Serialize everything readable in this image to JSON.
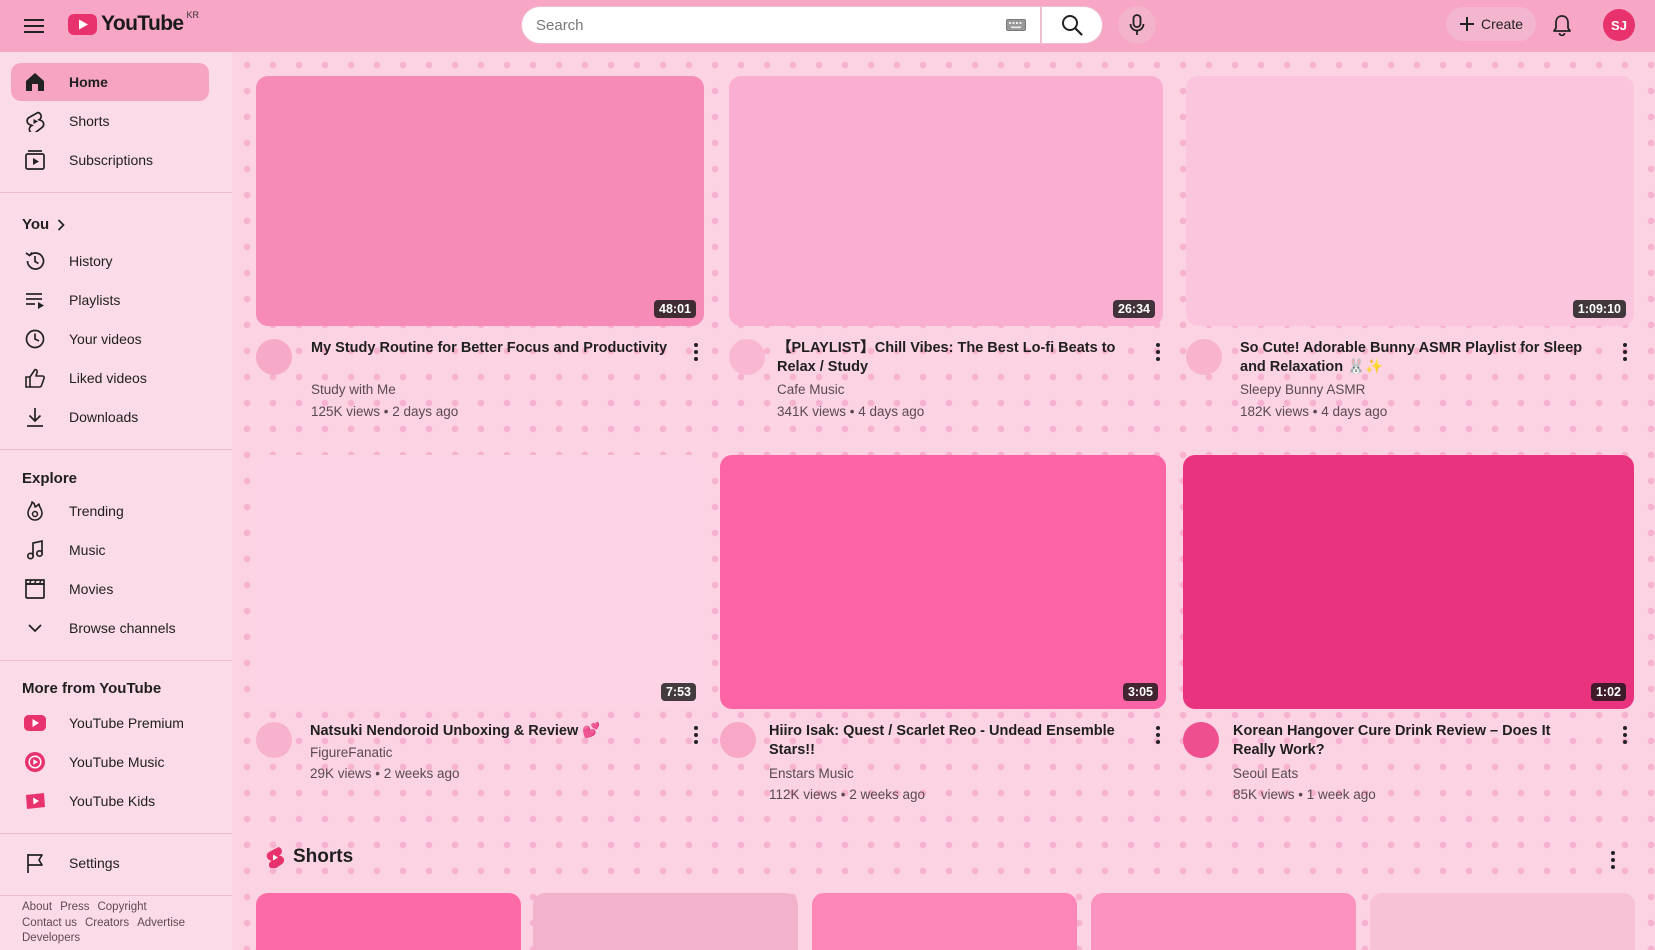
{
  "header": {
    "logo_text": "YouTube",
    "region": "KR",
    "search_placeholder": "Search",
    "create_label": "Create",
    "avatar_initials": "SJ"
  },
  "sidebar": {
    "main": [
      {
        "label": "Home",
        "icon": "home-icon"
      },
      {
        "label": "Shorts",
        "icon": "shorts-icon"
      },
      {
        "label": "Subscriptions",
        "icon": "subscriptions-icon"
      }
    ],
    "you_title": "You",
    "you": [
      {
        "label": "History",
        "icon": "history-icon"
      },
      {
        "label": "Playlists",
        "icon": "playlists-icon"
      },
      {
        "label": "Your videos",
        "icon": "your-videos-icon"
      },
      {
        "label": "Liked videos",
        "icon": "thumbs-up-icon"
      },
      {
        "label": "Downloads",
        "icon": "download-icon"
      }
    ],
    "explore_title": "Explore",
    "explore": [
      {
        "label": "Trending",
        "icon": "trending-icon"
      },
      {
        "label": "Music",
        "icon": "music-note-icon"
      },
      {
        "label": "Movies",
        "icon": "clapperboard-icon"
      },
      {
        "label": "Browse channels",
        "icon": "chevron-down-icon"
      }
    ],
    "more_title": "More from YouTube",
    "more": [
      {
        "label": "YouTube Premium",
        "icon": "youtube-premium-icon"
      },
      {
        "label": "YouTube Music",
        "icon": "youtube-music-icon"
      },
      {
        "label": "YouTube Kids",
        "icon": "youtube-kids-icon"
      }
    ],
    "settings_label": "Settings",
    "footer": {
      "line1": [
        "About",
        "Press",
        "Copyright"
      ],
      "line2": [
        "Contact us",
        "Creators",
        "Advertise"
      ],
      "line3": [
        "Developers"
      ]
    }
  },
  "videos": [
    {
      "title": "My Study Routine for Better Focus and Productivity",
      "channel": "Study with Me",
      "meta": "125K views • 2 days ago",
      "duration": "48:01",
      "thumb_color": "#f58bb6",
      "avatar_color": "#f7a9c8"
    },
    {
      "title": "【PLAYLIST】Chill Vibes: The Best Lo-fi Beats to Relax / Study",
      "channel": "Cafe Music",
      "meta": "341K views • 4 days ago",
      "duration": "26:34",
      "thumb_color": "#faafd2",
      "avatar_color": "#f9b7d2"
    },
    {
      "title": "So Cute! Adorable Bunny ASMR Playlist for Sleep and Relaxation 🐰✨",
      "channel": "Sleepy Bunny ASMR",
      "meta": "182K views • 4 days ago",
      "duration": "1:09:10",
      "thumb_color": "#fbc6dd",
      "avatar_color": "#f8b3cd"
    },
    {
      "title": "Natsuki Nendoroid Unboxing & Review 💕",
      "channel": "FigureFanatic",
      "meta": "29K views • 2 weeks ago",
      "duration": "7:53",
      "thumb_color": "#fcd4e5",
      "avatar_color": "#f7b2cd"
    },
    {
      "title": "Hiiro Isak: Quest / Scarlet Reo - Undead Ensemble Stars!!",
      "channel": "Enstars Music",
      "meta": "112K views • 2 weeks ago",
      "duration": "3:05",
      "thumb_color": "#fd64a5",
      "avatar_color": "#f9a7c6"
    },
    {
      "title": "Korean Hangover Cure Drink Review – Does It Really Work?",
      "channel": "Seoul Eats",
      "meta": "85K views • 1 week ago",
      "duration": "1:02",
      "thumb_color": "#e9337f",
      "avatar_color": "#ee4f8f"
    }
  ],
  "shorts": {
    "title": "Shorts",
    "items": [
      {
        "color": "#fd6aa8"
      },
      {
        "color": "#f3b2cc"
      },
      {
        "color": "#fc86b8"
      },
      {
        "color": "#fb92bf"
      },
      {
        "color": "#f7c2d6"
      }
    ]
  }
}
